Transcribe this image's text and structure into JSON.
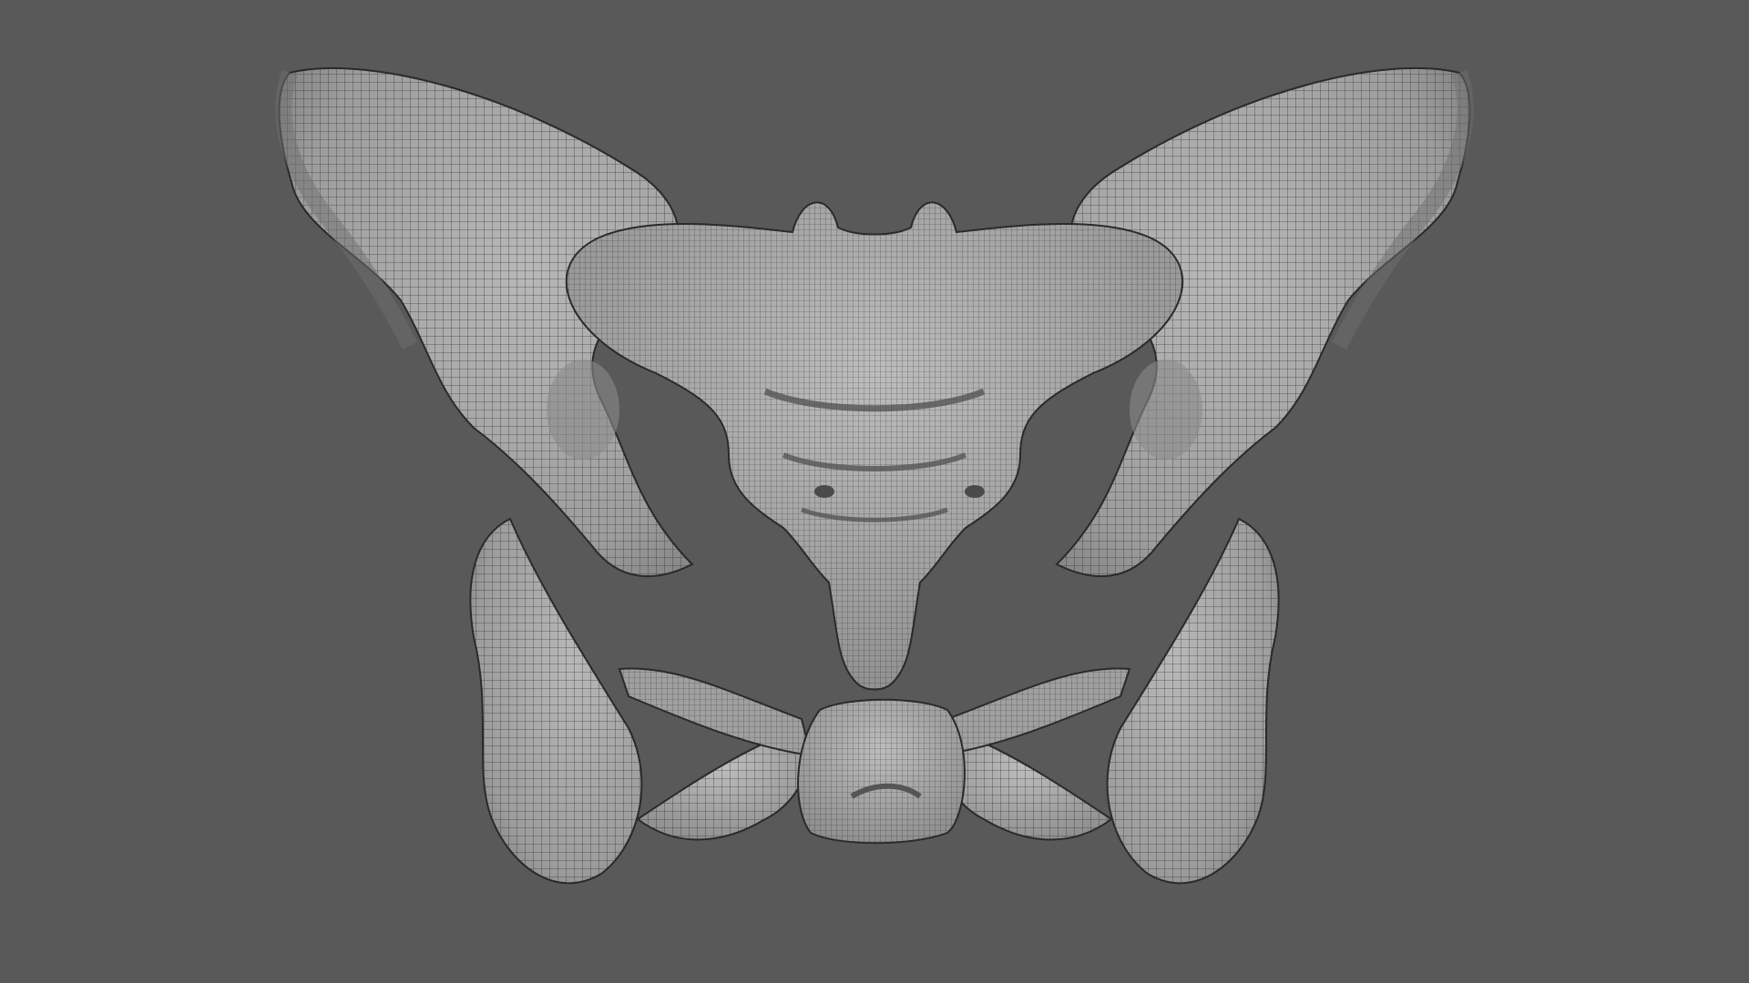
{
  "scene": {
    "subject": "pelvis-mesh",
    "render_mode": "wireframe-on-shaded",
    "colors": {
      "background": "#595959",
      "mesh_fill": "#a9a9a9",
      "mesh_shadow": "#6f6f6f",
      "wire": "#2a2a2a",
      "highlight": "#c8c8c8"
    }
  }
}
